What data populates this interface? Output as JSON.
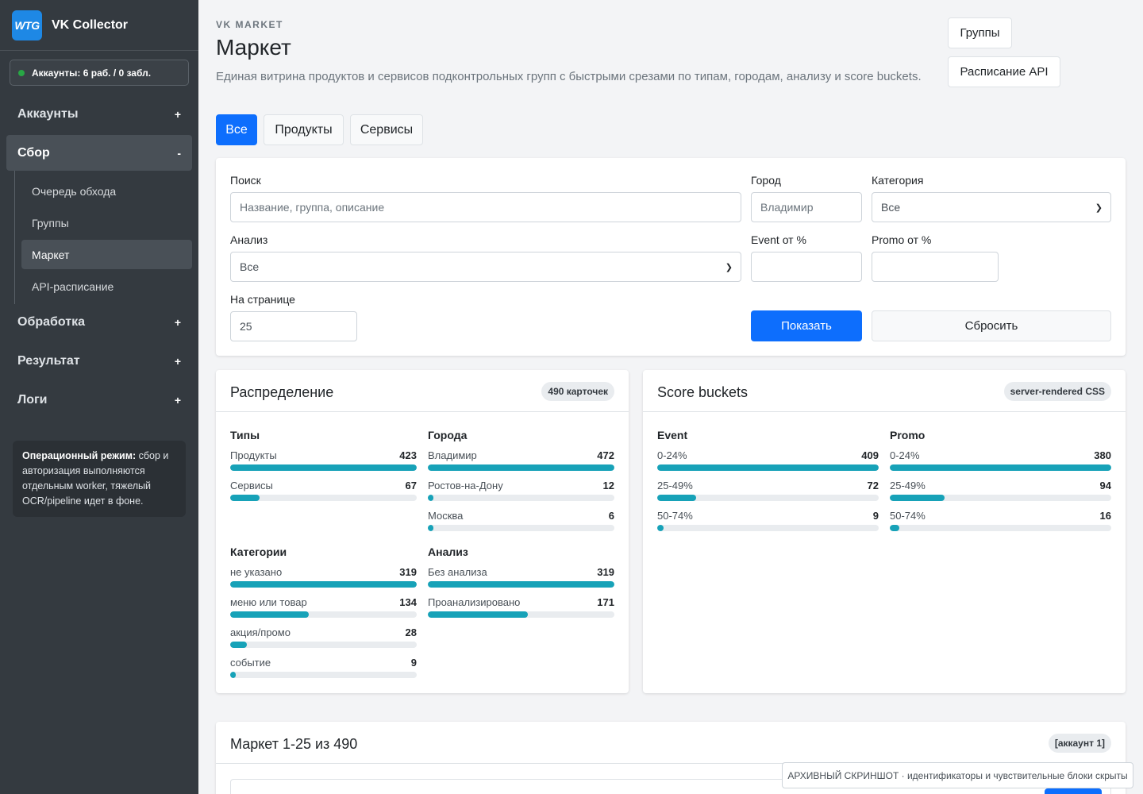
{
  "sidebar": {
    "logo_text": "WTG",
    "brand": "VK Collector",
    "accounts_status": "Аккаунты: 6 раб. / 0 забл.",
    "sections": [
      {
        "label": "Аккаунты",
        "sign": "+"
      },
      {
        "label": "Сбор",
        "sign": "-"
      },
      {
        "label": "Обработка",
        "sign": "+"
      },
      {
        "label": "Результат",
        "sign": "+"
      },
      {
        "label": "Логи",
        "sign": "+"
      }
    ],
    "subitems": [
      "Очередь обхода",
      "Группы",
      "Маркет",
      "API-расписание"
    ],
    "op_title": "Операционный режим:",
    "op_text": " сбор и авторизация выполняются отдельным worker, тяжелый OCR/pipeline идет в фоне."
  },
  "header": {
    "eyebrow": "VK MARKET",
    "title": "Маркет",
    "description": "Единая витрина продуктов и сервисов подконтрольных групп с быстрыми срезами по типам, городам, анализу и score buckets.",
    "btn_groups": "Группы",
    "btn_api": "Расписание API"
  },
  "tabs": [
    "Все",
    "Продукты",
    "Сервисы"
  ],
  "filters": {
    "search_label": "Поиск",
    "search_placeholder": "Название, группа, описание",
    "city_label": "Город",
    "city_placeholder": "Владимир",
    "category_label": "Категория",
    "category_value": "Все",
    "analysis_label": "Анализ",
    "analysis_value": "Все",
    "event_label": "Event от %",
    "promo_label": "Promo от %",
    "per_page_label": "На странице",
    "per_page_value": "25",
    "show_btn": "Показать",
    "reset_btn": "Сбросить"
  },
  "distribution": {
    "title": "Распределение",
    "badge": "490 карточек",
    "groups": [
      {
        "title": "Типы",
        "max": 423,
        "rows": [
          {
            "label": "Продукты",
            "value": 423
          },
          {
            "label": "Сервисы",
            "value": 67
          }
        ]
      },
      {
        "title": "Города",
        "max": 472,
        "rows": [
          {
            "label": "Владимир",
            "value": 472
          },
          {
            "label": "Ростов-на-Дону",
            "value": 12
          },
          {
            "label": "Москва",
            "value": 6
          }
        ]
      },
      {
        "title": "Категории",
        "max": 319,
        "rows": [
          {
            "label": "не указано",
            "value": 319
          },
          {
            "label": "меню или товар",
            "value": 134
          },
          {
            "label": "акция/промо",
            "value": 28
          },
          {
            "label": "событие",
            "value": 9
          }
        ]
      },
      {
        "title": "Анализ",
        "max": 319,
        "rows": [
          {
            "label": "Без анализа",
            "value": 319
          },
          {
            "label": "Проанализировано",
            "value": 171
          }
        ]
      }
    ]
  },
  "score": {
    "title": "Score buckets",
    "badge": "server-rendered CSS",
    "groups": [
      {
        "title": "Event",
        "max": 409,
        "rows": [
          {
            "label": "0-24%",
            "value": 409
          },
          {
            "label": "25-49%",
            "value": 72
          },
          {
            "label": "50-74%",
            "value": 9
          }
        ]
      },
      {
        "title": "Promo",
        "max": 380,
        "rows": [
          {
            "label": "0-24%",
            "value": 380
          },
          {
            "label": "25-49%",
            "value": 94
          },
          {
            "label": "50-74%",
            "value": 16
          }
        ]
      }
    ]
  },
  "market": {
    "title": "Маркет 1-25 из 490",
    "badge": "[аккаунт 1]"
  },
  "archive_note": "АРХИВНЫЙ СКРИНШОТ · идентификаторы и чувствительные блоки скрыты",
  "colors": {
    "primary": "#0d6efd",
    "bar": "#17a2b8",
    "sidebar": "#343a40",
    "status_dot": "#28a745"
  }
}
